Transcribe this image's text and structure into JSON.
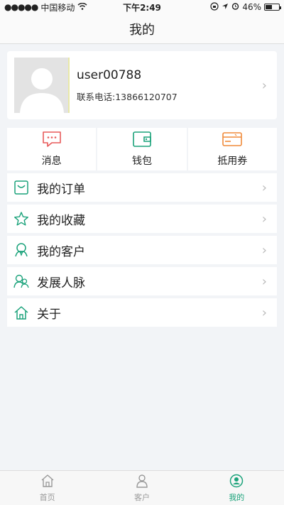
{
  "status_bar": {
    "signal": "●●●●●",
    "carrier": "中国移动",
    "time": "下午2:49",
    "battery_percent": "46%"
  },
  "nav": {
    "title": "我的"
  },
  "profile": {
    "username": "user00788",
    "phone": "联系电话:13866120707"
  },
  "quick_actions": [
    {
      "label": "消息",
      "icon": "message-icon"
    },
    {
      "label": "钱包",
      "icon": "wallet-icon"
    },
    {
      "label": "抵用券",
      "icon": "coupon-icon"
    }
  ],
  "menu": [
    {
      "label": "我的订单",
      "icon": "bag-icon"
    },
    {
      "label": "我的收藏",
      "icon": "star-icon"
    },
    {
      "label": "我的客户",
      "icon": "customers-icon"
    },
    {
      "label": "发展人脉",
      "icon": "network-icon"
    },
    {
      "label": "关于",
      "icon": "home-icon"
    }
  ],
  "tabs": [
    {
      "label": "首页",
      "icon": "home-tab-icon",
      "active": false
    },
    {
      "label": "客户",
      "icon": "person-tab-icon",
      "active": false
    },
    {
      "label": "我的",
      "icon": "me-tab-icon",
      "active": true
    }
  ],
  "colors": {
    "accent": "#1aa27a",
    "message_red": "#e85a5a",
    "wallet_green": "#1aa27a",
    "coupon_orange": "#f08a3a"
  }
}
